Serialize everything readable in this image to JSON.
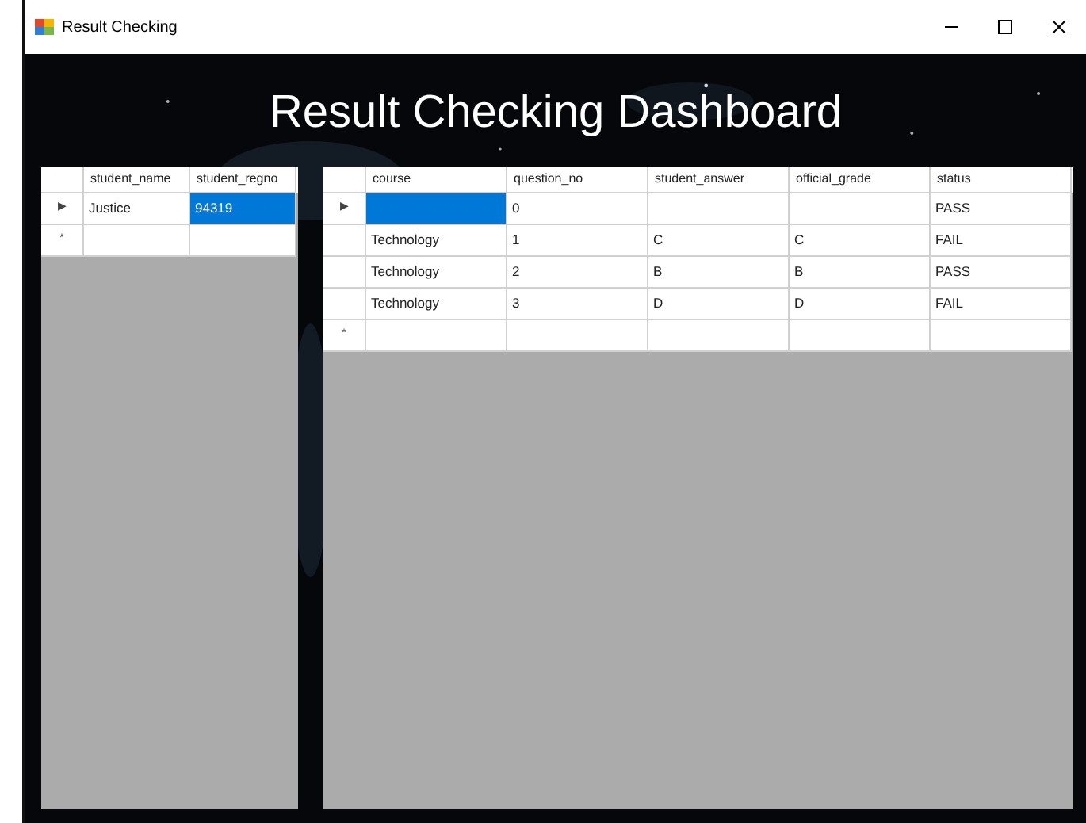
{
  "window": {
    "title": "Result Checking"
  },
  "heading": "Result Checking Dashboard",
  "students_grid": {
    "columns": [
      "student_name",
      "student_regno"
    ],
    "rows": [
      {
        "marker": "▶",
        "cells": [
          {
            "text": "Justice",
            "selected": false
          },
          {
            "text": "94319",
            "selected": true
          }
        ]
      },
      {
        "marker": "*",
        "cells": [
          {
            "selected": false
          },
          {
            "selected": false
          }
        ]
      }
    ]
  },
  "results_grid": {
    "columns": [
      "course",
      "question_no",
      "student_answer",
      "official_grade",
      "status"
    ],
    "rows": [
      {
        "marker": "▶",
        "cells": [
          {
            "selected": true
          },
          {
            "text": "0",
            "selected": false
          },
          {
            "selected": false
          },
          {
            "selected": false
          },
          {
            "text": "PASS",
            "selected": false
          }
        ]
      },
      {
        "cells": [
          {
            "text": "Technology",
            "selected": false
          },
          {
            "text": "1",
            "selected": false
          },
          {
            "text": "C",
            "selected": false
          },
          {
            "text": "C",
            "selected": false
          },
          {
            "text": "FAIL",
            "selected": false
          }
        ]
      },
      {
        "cells": [
          {
            "text": "Technology",
            "selected": false
          },
          {
            "text": "2",
            "selected": false
          },
          {
            "text": "B",
            "selected": false
          },
          {
            "text": "B",
            "selected": false
          },
          {
            "text": "PASS",
            "selected": false
          }
        ]
      },
      {
        "cells": [
          {
            "text": "Technology",
            "selected": false
          },
          {
            "text": "3",
            "selected": false
          },
          {
            "text": "D",
            "selected": false
          },
          {
            "text": "D",
            "selected": false
          },
          {
            "text": "FAIL",
            "selected": false
          }
        ]
      },
      {
        "marker": "*",
        "cells": [
          {
            "selected": false
          },
          {
            "selected": false
          },
          {
            "selected": false
          },
          {
            "selected": false
          },
          {
            "selected": false
          }
        ]
      }
    ]
  }
}
